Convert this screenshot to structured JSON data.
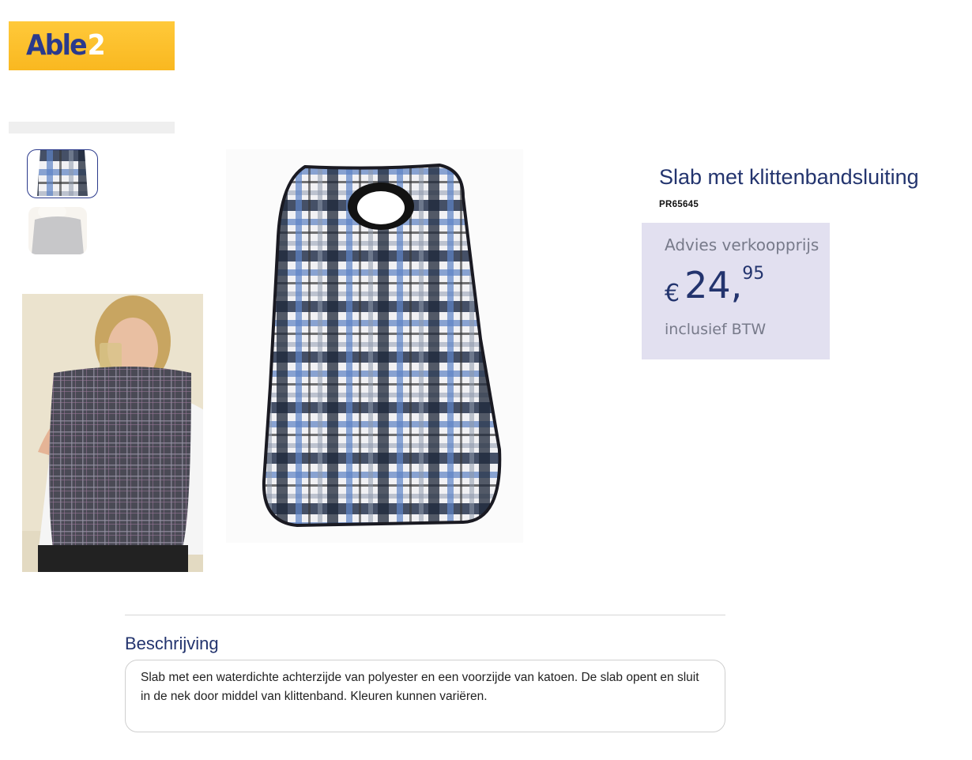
{
  "header": {
    "logo_text_main": "Able",
    "logo_text_accent": "2"
  },
  "gallery": {
    "thumbnails": [
      {
        "label": "plaid-bib-thumbnail",
        "selected": true
      },
      {
        "label": "gray-bib-thumbnail",
        "selected": false
      }
    ]
  },
  "product": {
    "title": "Slab met klittenbandsluiting",
    "code": "PR65645"
  },
  "price": {
    "label": "Advies verkoopprijs",
    "currency": "€",
    "euros": "24,",
    "cents": "95",
    "vat_note": "inclusief BTW"
  },
  "description": {
    "heading": "Beschrijving",
    "text": "Slab met een waterdichte achterzijde van polyester en een voorzijde van katoen. De slab opent en sluit in de nek door middel van klittenband. Kleuren kunnen variëren."
  },
  "colors": {
    "brand_navy": "#23346e",
    "logo_yellow": "#fbbd2a",
    "price_box_bg": "#e2e0f0"
  }
}
